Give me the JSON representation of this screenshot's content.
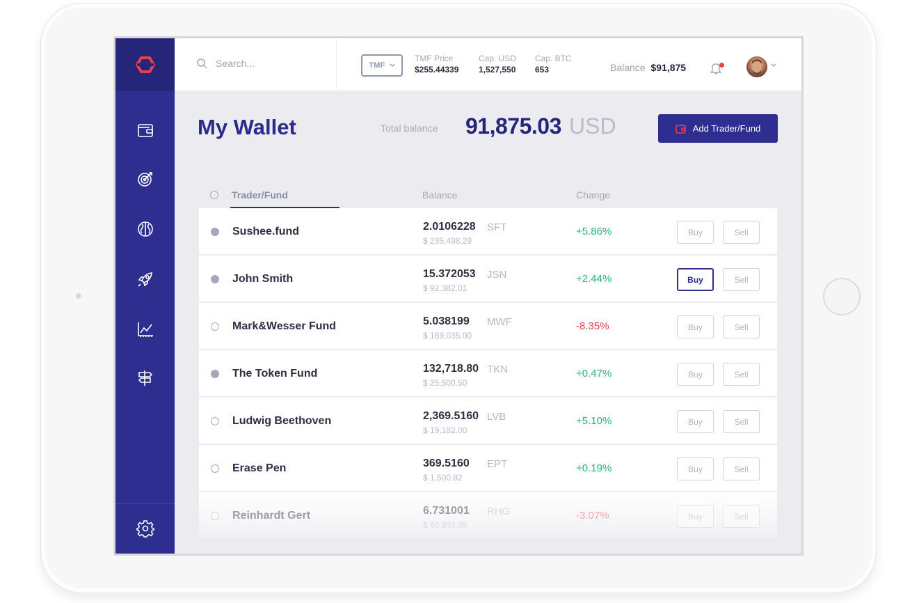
{
  "search": {
    "placeholder": "Search..."
  },
  "header": {
    "currency_select": "TMF",
    "stats": [
      {
        "label": "TMF Price",
        "value": "$255.44339"
      },
      {
        "label": "Cap. USD",
        "value": "1,527,550"
      },
      {
        "label": "Cap. BTC",
        "value": "653"
      }
    ],
    "balance_label": "Balance",
    "balance_value": "$91,875"
  },
  "sidebar": {
    "items": [
      {
        "icon": "wallet-icon"
      },
      {
        "icon": "target-icon"
      },
      {
        "icon": "brain-icon"
      },
      {
        "icon": "rocket-icon"
      },
      {
        "icon": "chart-icon"
      },
      {
        "icon": "signpost-icon"
      }
    ],
    "footer_icon": "gear-icon"
  },
  "main": {
    "title": "My Wallet",
    "total_label": "Total balance",
    "total_value": "91,875.03",
    "total_currency": "USD",
    "add_button": "Add Trader/Fund"
  },
  "table": {
    "columns": [
      "Trader/Fund",
      "Balance",
      "Change"
    ],
    "buy_label": "Buy",
    "sell_label": "Sell",
    "rows": [
      {
        "name": "Sushee.fund",
        "amount": "2.0106228",
        "ticker": "SFT",
        "usd": "$ 235,498.29",
        "change": "+5.86%",
        "trend": "pos",
        "selected": true
      },
      {
        "name": "John Smith",
        "amount": "15.372053",
        "ticker": "JSN",
        "usd": "$ 92,382.01",
        "change": "+2.44%",
        "trend": "pos",
        "selected": true
      },
      {
        "name": "Mark&Wesser Fund",
        "amount": "5.038199",
        "ticker": "MWF",
        "usd": "$ 189,035.00",
        "change": "-8.35%",
        "trend": "neg",
        "selected": false
      },
      {
        "name": "The Token Fund",
        "amount": "132,718.80",
        "ticker": "TKN",
        "usd": "$ 25,500.50",
        "change": "+0.47%",
        "trend": "pos",
        "selected": true
      },
      {
        "name": "Ludwig Beethoven",
        "amount": "2,369.5160",
        "ticker": "LVB",
        "usd": "$ 19,182.00",
        "change": "+5.10%",
        "trend": "pos",
        "selected": false
      },
      {
        "name": "Erase Pen",
        "amount": "369.5160",
        "ticker": "EPT",
        "usd": "$ 1,500.82",
        "change": "+0.19%",
        "trend": "pos",
        "selected": false
      },
      {
        "name": "Reinhardt Gert",
        "amount": "6.731001",
        "ticker": "RHG",
        "usd": "$ 60,933.08",
        "change": "-3.07%",
        "trend": "neg",
        "selected": false
      }
    ]
  },
  "colors": {
    "brand": "#2d2e8f",
    "positive": "#2ab27b",
    "negative": "#e8414e",
    "logo": "#e8414e"
  }
}
